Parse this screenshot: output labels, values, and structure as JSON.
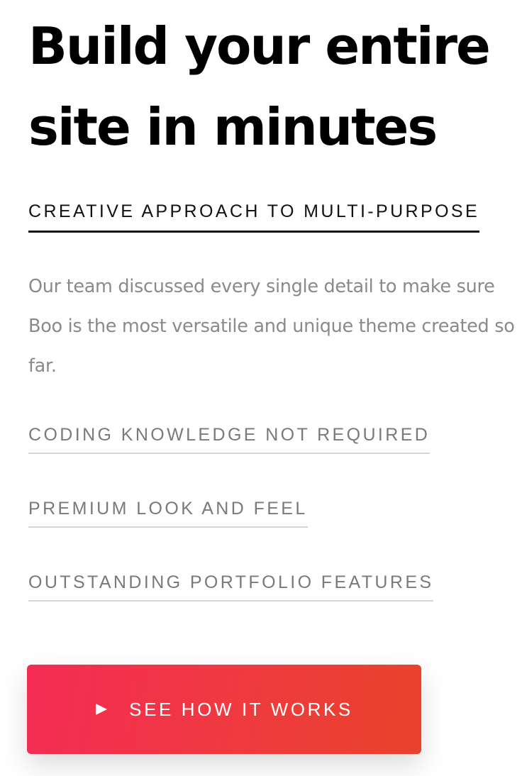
{
  "hero": {
    "title": "Build your entire site in minutes"
  },
  "intro": {
    "subheading": "CREATIVE APPROACH TO MULTI-PURPOSE",
    "description": "Our team discussed every single detail to make sure Boo is the most versatile and unique theme created so far."
  },
  "features": [
    {
      "label": "CODING KNOWLEDGE NOT REQUIRED"
    },
    {
      "label": "PREMIUM LOOK AND FEEL"
    },
    {
      "label": "OUTSTANDING PORTFOLIO FEATURES"
    }
  ],
  "cta": {
    "label": "SEE HOW IT WORKS",
    "icon": "play-icon",
    "gradient_start": "#f42c55",
    "gradient_end": "#e8432b"
  }
}
